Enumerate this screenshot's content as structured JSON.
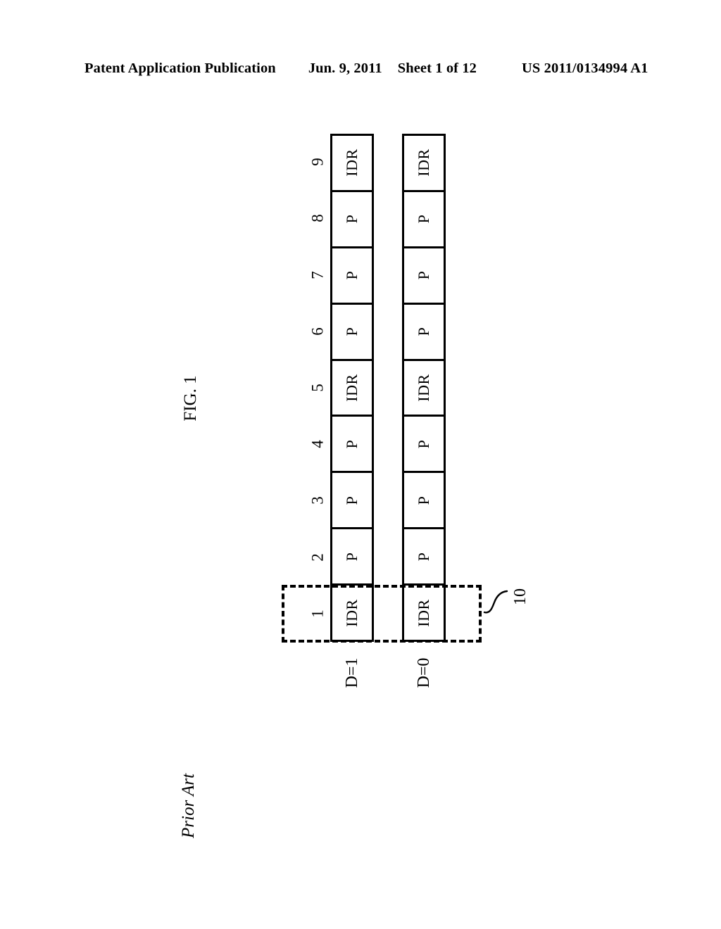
{
  "header": {
    "publication": "Patent Application Publication",
    "date": "Jun. 9, 2011",
    "sheet": "Sheet 1 of 12",
    "doc_number": "US 2011/0134994 A1"
  },
  "figure": {
    "label": "FIG. 1",
    "note": "Prior Art",
    "reference_numeral": "10",
    "rows": [
      {
        "name": "row-d1",
        "label": "D=1",
        "cells": [
          "IDR",
          "P",
          "P",
          "P",
          "IDR",
          "P",
          "P",
          "P",
          "IDR"
        ]
      },
      {
        "name": "row-d0",
        "label": "D=0",
        "cells": [
          "IDR",
          "P",
          "P",
          "P",
          "IDR",
          "P",
          "P",
          "P",
          "IDR"
        ]
      }
    ],
    "indices": [
      "1",
      "2",
      "3",
      "4",
      "5",
      "6",
      "7",
      "8",
      "9"
    ]
  },
  "colors": {
    "ink": "#000000",
    "paper": "#ffffff"
  }
}
